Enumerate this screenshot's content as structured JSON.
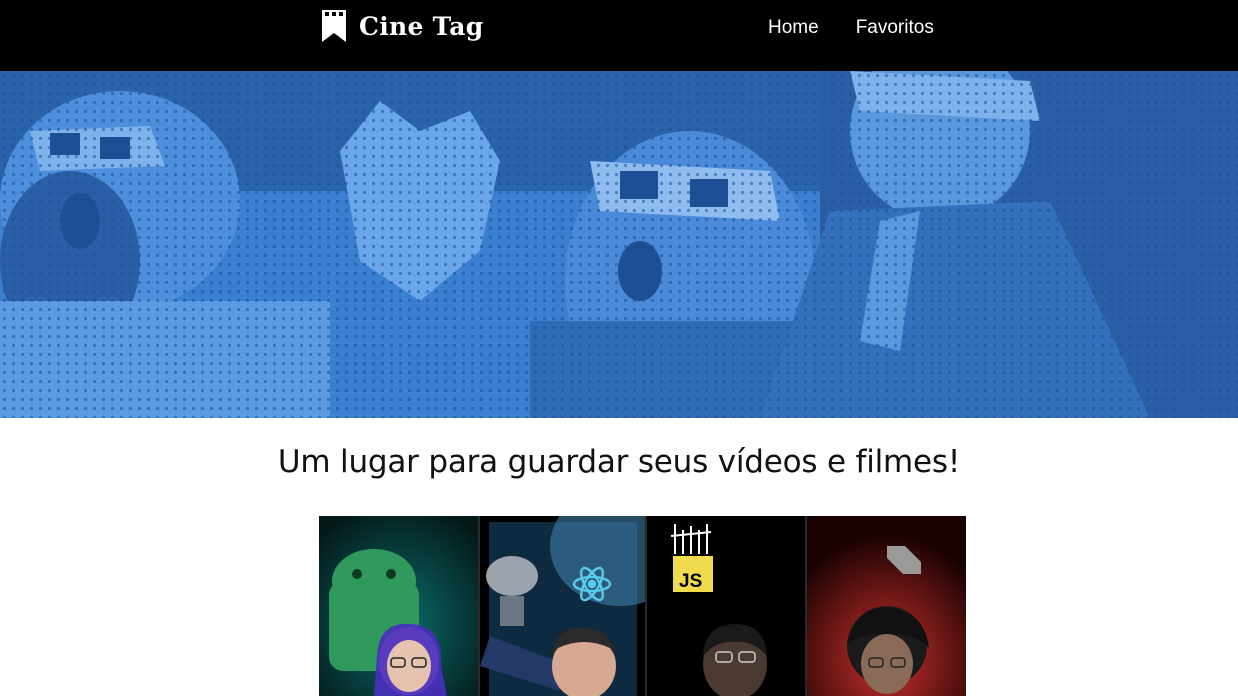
{
  "header": {
    "logo_text": "Cine Tag",
    "logo_icon": "bookmark-film-icon",
    "nav": [
      {
        "label": "Home"
      },
      {
        "label": "Favoritos"
      }
    ]
  },
  "banner": {
    "image": "audience-3d-glasses-blue-halftone"
  },
  "main": {
    "title": "Um lugar para guardar seus vídeos e filmes!"
  },
  "videos": [
    {
      "thumbnail": "android-mascot-presenter"
    },
    {
      "thumbnail": "react-satellite-presenter"
    },
    {
      "thumbnail": "js-logo-presenter"
    },
    {
      "thumbnail": "dart-logo-presenter"
    }
  ],
  "colors": {
    "header_bg": "#000000",
    "banner_tint": "#2e6fc0",
    "title_text": "#111111"
  }
}
